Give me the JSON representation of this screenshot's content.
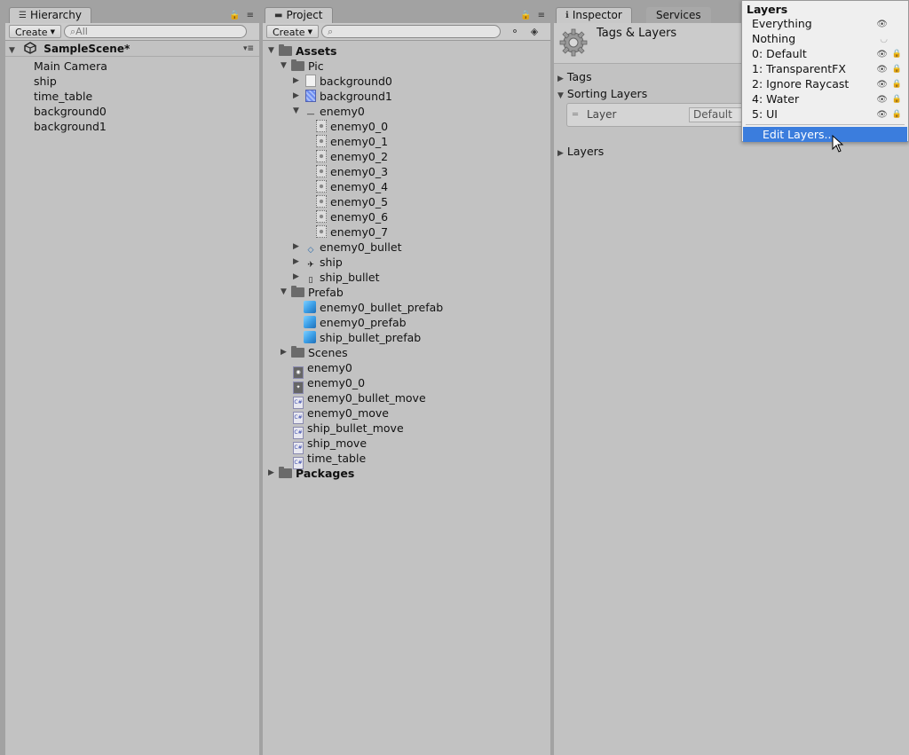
{
  "hierarchy": {
    "tab_label": "Hierarchy",
    "create_label": "Create",
    "search_placeholder": "All",
    "scene_name": "SampleScene*",
    "items": [
      "Main Camera",
      "ship",
      "time_table",
      "background0",
      "background1"
    ]
  },
  "project": {
    "tab_label": "Project",
    "create_label": "Create",
    "tree": {
      "assets": "Assets",
      "pic": "Pic",
      "background0": "background0",
      "background1": "background1",
      "enemy0": "enemy0",
      "enemy0_children": [
        "enemy0_0",
        "enemy0_1",
        "enemy0_2",
        "enemy0_3",
        "enemy0_4",
        "enemy0_5",
        "enemy0_6",
        "enemy0_7"
      ],
      "enemy0_bullet": "enemy0_bullet",
      "ship": "ship",
      "ship_bullet": "ship_bullet",
      "prefab": "Prefab",
      "prefab_items": [
        "enemy0_bullet_prefab",
        "enemy0_prefab",
        "ship_bullet_prefab"
      ],
      "scenes": "Scenes",
      "root_files": [
        "enemy0",
        "enemy0_0",
        "enemy0_bullet_move",
        "enemy0_move",
        "ship_bullet_move",
        "ship_move",
        "time_table"
      ],
      "packages": "Packages"
    }
  },
  "inspector": {
    "tab_label": "Inspector",
    "services_tab": "Services",
    "title": "Tags & Layers",
    "tags": "Tags",
    "sorting_layers": "Sorting Layers",
    "layer_label": "Layer",
    "layer_value": "Default",
    "layers": "Layers"
  },
  "layers_menu": {
    "title": "Layers",
    "items": [
      "Everything",
      "Nothing",
      "0: Default",
      "1: TransparentFX",
      "2: Ignore Raycast",
      "4: Water",
      "5: UI"
    ],
    "edit_label": "Edit Layers..."
  },
  "colors": {
    "selection": "#3b7ddd",
    "panel": "#c2c2c2",
    "background": "#a2a2a2"
  }
}
